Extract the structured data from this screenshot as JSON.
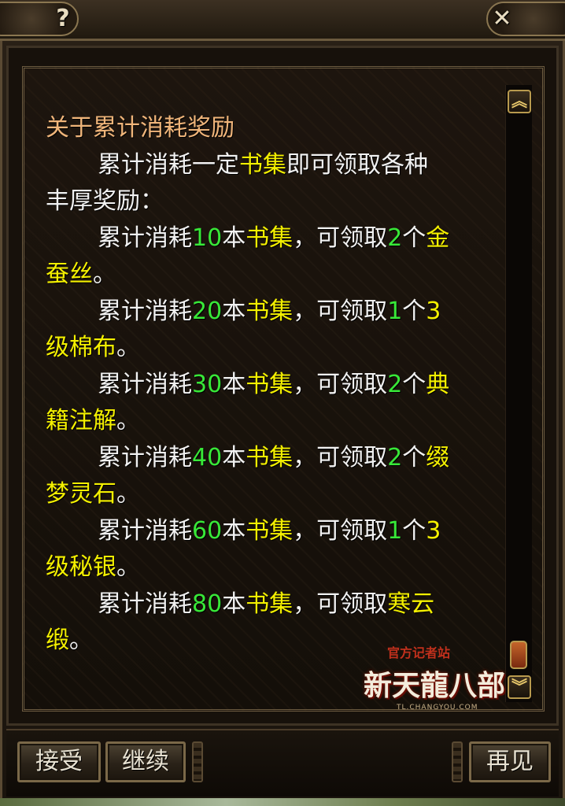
{
  "titlebar": {
    "help_label": "?",
    "close_label": "✕"
  },
  "dialog": {
    "heading": "关于累计消耗奖励",
    "intro_part1": "累计消耗一定",
    "intro_item": "书集",
    "intro_part2": "即可领取各种",
    "intro_part3": "丰厚奖励：",
    "prefix": "累计消耗",
    "unit": "本",
    "item": "书集",
    "claim": "，可领取",
    "rewards": [
      {
        "amount": "10",
        "count": "2",
        "measure": "个",
        "name_line1": "金",
        "name_line2": "蚕丝"
      },
      {
        "amount": "20",
        "count": "1",
        "measure": "个",
        "level": "3",
        "name_line2": "级棉布"
      },
      {
        "amount": "30",
        "count": "2",
        "measure": "个",
        "name_line1": "典",
        "name_line2": "籍注解"
      },
      {
        "amount": "40",
        "count": "2",
        "measure": "个",
        "name_line1": "缀",
        "name_line2": "梦灵石"
      },
      {
        "amount": "60",
        "count": "1",
        "measure": "个",
        "level": "3",
        "name_line2": "级秘银"
      },
      {
        "amount": "80",
        "name_line1": "寒云",
        "name_line2": "缎"
      }
    ],
    "period": "。"
  },
  "watermark": {
    "top": "官方记者站",
    "main": "新天龍八部",
    "sub": "TL.CHANGYOU.COM"
  },
  "buttons": {
    "accept": "接受",
    "continue": "继续",
    "goodbye": "再见"
  },
  "scroll": {
    "up_icon": "double-chevron-up",
    "down_icon": "double-chevron-down"
  },
  "colors": {
    "heading": "#f0b57a",
    "item_yellow": "#f4f000",
    "number_green": "#38e838",
    "body_text": "#f2f2f2"
  }
}
